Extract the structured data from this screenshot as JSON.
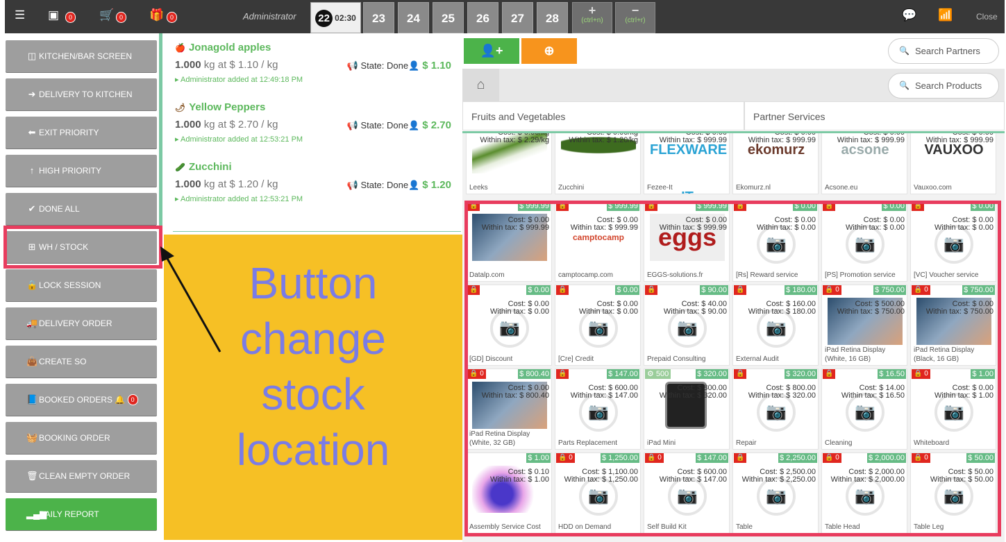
{
  "topbar": {
    "admin": "Administrator",
    "badges": [
      "0",
      "0",
      "0"
    ],
    "active_tab": {
      "num": "22",
      "time": "02:30"
    },
    "tabs": [
      "23",
      "24",
      "25",
      "26",
      "27",
      "28"
    ],
    "add_tab": "(ctrl+n)",
    "remove_tab": "(ctrl+r)",
    "close": "Close",
    "colors": {
      "bar": "#393939",
      "wifi": "#5cb85c"
    }
  },
  "left_buttons": [
    {
      "label": "KITCHEN/BAR SCREEN",
      "icon": "screen-icon"
    },
    {
      "label": "DELIVERY TO KITCHEN",
      "icon": "arrow-right-circle-icon"
    },
    {
      "label": "EXIT PRIORITY",
      "icon": "arrow-left-circle-icon"
    },
    {
      "label": "HIGH PRIORITY",
      "icon": "arrow-up-icon"
    },
    {
      "label": "DONE ALL",
      "icon": "check-circle-icon"
    },
    {
      "label": "WH / STOCK",
      "icon": "sitemap-icon"
    },
    {
      "label": "LOCK SESSION",
      "icon": "lock-icon"
    },
    {
      "label": "DELIVERY ORDER",
      "icon": "truck-icon"
    },
    {
      "label": "CREATE SO",
      "icon": "shopping-bag-icon"
    },
    {
      "label": "BOOKED ORDERS",
      "icon": "book-icon",
      "badge": "0"
    },
    {
      "label": "BOOKING ORDER",
      "icon": "basket-icon"
    },
    {
      "label": "CLEAN EMPTY ORDER",
      "icon": "trash-icon"
    },
    {
      "label": "DAILY REPORT",
      "icon": "signal-icon"
    }
  ],
  "orderlines": [
    {
      "name": "Jonagold apples",
      "qty": "1.000",
      "unit": "kg at $ 1.10 / kg",
      "state": "State: Done",
      "price": "$ 1.10",
      "who": "Administrator added at 12:49:18 PM"
    },
    {
      "name": "Yellow Peppers",
      "qty": "1.000",
      "unit": "kg at $ 2.70 / kg",
      "state": "State: Done",
      "price": "$ 2.70",
      "who": "Administrator added at 12:53:21 PM"
    },
    {
      "name": "Zucchini",
      "qty": "1.000",
      "unit": "kg at $ 1.20 / kg",
      "state": "State: Done",
      "price": "$ 1.20",
      "who": "Administrator added at 12:53:21 PM"
    }
  ],
  "annotation": {
    "lines": [
      "Button",
      "change",
      "stock",
      "location"
    ]
  },
  "search_partners": "Search Partners",
  "search_products": "Search Products",
  "categories": [
    "Fruits and Vegetables",
    "Partner Services"
  ],
  "products": [
    {
      "name": "Leeks",
      "cost": "Cost: $ 0.00/kg",
      "tax": "Within tax: $ 2.29/kg",
      "price": "",
      "lock": "",
      "img": "leek"
    },
    {
      "name": "Zucchini",
      "cost": "Cost: $ 0.00/kg",
      "tax": "Within tax: $ 1.20/kg",
      "price": "",
      "lock": "",
      "img": "zucchini"
    },
    {
      "name": "Fezee-It",
      "cost": "Cost: $ 0.00",
      "tax": "Within tax: $ 999.99",
      "price": "",
      "lock": "",
      "img": "flexware",
      "logo": "FLEXWARE IT"
    },
    {
      "name": "Ekomurz.nl",
      "cost": "Cost: $ 0.00",
      "tax": "Within tax: $ 999.99",
      "price": "",
      "lock": "",
      "img": "logo",
      "logo": "ekomurz"
    },
    {
      "name": "Acsone.eu",
      "cost": "Cost: $ 0.00",
      "tax": "Within tax: $ 999.99",
      "price": "",
      "lock": "",
      "img": "logo",
      "logo": "acsone"
    },
    {
      "name": "Vauxoo.com",
      "cost": "Cost: $ 0.00",
      "tax": "Within tax: $ 999.99",
      "price": "",
      "lock": "",
      "img": "logo",
      "logo": "VAUXOO"
    },
    {
      "name": "Datalp.com",
      "cost": "Cost: $ 0.00",
      "tax": "Within tax: $ 999.99",
      "price": "$ 999.99",
      "lock": "lock",
      "img": "photo"
    },
    {
      "name": "camptocamp.com",
      "cost": "Cost: $ 0.00",
      "tax": "Within tax: $ 999.99",
      "price": "$ 999.99",
      "lock": "lock",
      "img": "logo",
      "logo": "camptocamp"
    },
    {
      "name": "EGGS-solutions.fr",
      "cost": "Cost: $ 0.00",
      "tax": "Within tax: $ 999.99",
      "price": "$ 999.99",
      "lock": "lock",
      "img": "logo",
      "logo": "eggs"
    },
    {
      "name": "[Rs] Reward service",
      "cost": "Cost: $ 0.00",
      "tax": "Within tax: $ 0.00",
      "price": "$ 0.00",
      "lock": "lock",
      "img": "none"
    },
    {
      "name": "[PS] Promotion service",
      "cost": "Cost: $ 0.00",
      "tax": "Within tax: $ 0.00",
      "price": "$ 0.00",
      "lock": "lock",
      "img": "none"
    },
    {
      "name": "[VC] Voucher service",
      "cost": "Cost: $ 0.00",
      "tax": "Within tax: $ 0.00",
      "price": "$ 0.00",
      "lock": "lock",
      "img": "none"
    },
    {
      "name": "[GD] Discount",
      "cost": "Cost: $ 0.00",
      "tax": "Within tax: $ 0.00",
      "price": "$ 0.00",
      "lock": "lock",
      "img": "none"
    },
    {
      "name": "[Cre] Credit",
      "cost": "Cost: $ 0.00",
      "tax": "Within tax: $ 0.00",
      "price": "$ 0.00",
      "lock": "lock",
      "img": "none"
    },
    {
      "name": "Prepaid Consulting",
      "cost": "Cost: $ 40.00",
      "tax": "Within tax: $ 90.00",
      "price": "$ 90.00",
      "lock": "lock",
      "img": "none"
    },
    {
      "name": "External Audit",
      "cost": "Cost: $ 160.00",
      "tax": "Within tax: $ 180.00",
      "price": "$ 180.00",
      "lock": "lock",
      "img": "none"
    },
    {
      "name": "iPad Retina Display (White, 16 GB)",
      "cost": "Cost: $ 500.00",
      "tax": "Within tax: $ 750.00",
      "price": "$ 750.00",
      "lock": "lock 0",
      "img": "photo"
    },
    {
      "name": "iPad Retina Display (Black, 16 GB)",
      "cost": "Cost: $ 0.00",
      "tax": "Within tax: $ 750.00",
      "price": "$ 750.00",
      "lock": "lock 0",
      "img": "photo"
    },
    {
      "name": "iPad Retina Display (White, 32 GB)",
      "cost": "Cost: $ 0.00",
      "tax": "Within tax: $ 800.40",
      "price": "$ 800.40",
      "lock": "lock 0",
      "img": "photo"
    },
    {
      "name": "Parts Replacement",
      "cost": "Cost: $ 600.00",
      "tax": "Within tax: $ 147.00",
      "price": "$ 147.00",
      "lock": "lock",
      "img": "none"
    },
    {
      "name": "iPad Mini",
      "cost": "Cost: $ 800.00",
      "tax": "Within tax: $ 320.00",
      "price": "$ 320.00",
      "lock": "stock 500",
      "img": "ipad"
    },
    {
      "name": "Repair",
      "cost": "Cost: $ 800.00",
      "tax": "Within tax: $ 320.00",
      "price": "$ 320.00",
      "lock": "lock",
      "img": "none"
    },
    {
      "name": "Cleaning",
      "cost": "Cost: $ 14.00",
      "tax": "Within tax: $ 16.50",
      "price": "$ 16.50",
      "lock": "lock",
      "img": "none"
    },
    {
      "name": "Whiteboard",
      "cost": "Cost: $ 0.00",
      "tax": "Within tax: $ 1.00",
      "price": "$ 1.00",
      "lock": "lock 0",
      "img": "none"
    },
    {
      "name": "Assembly Service Cost",
      "cost": "Cost: $ 0.10",
      "tax": "Within tax: $ 1.00",
      "price": "$ 1.00",
      "lock": "",
      "img": "puzzle"
    },
    {
      "name": "HDD on Demand",
      "cost": "Cost: $ 1,100.00",
      "tax": "Within tax: $ 1,250.00",
      "price": "$ 1,250.00",
      "lock": "lock 0",
      "img": "none"
    },
    {
      "name": "Self Build Kit",
      "cost": "Cost: $ 600.00",
      "tax": "Within tax: $ 147.00",
      "price": "$ 147.00",
      "lock": "lock 0",
      "img": "none"
    },
    {
      "name": "Table",
      "cost": "Cost: $ 2,500.00",
      "tax": "Within tax: $ 2,250.00",
      "price": "$ 2,250.00",
      "lock": "lock",
      "img": "none"
    },
    {
      "name": "Table Head",
      "cost": "Cost: $ 2,000.00",
      "tax": "Within tax: $ 2,000.00",
      "price": "$ 2,000.00",
      "lock": "lock 0",
      "img": "none"
    },
    {
      "name": "Table Leg",
      "cost": "Cost: $ 50.00",
      "tax": "Within tax: $ 50.00",
      "price": "$ 50.00",
      "lock": "lock 0",
      "img": "none"
    }
  ]
}
